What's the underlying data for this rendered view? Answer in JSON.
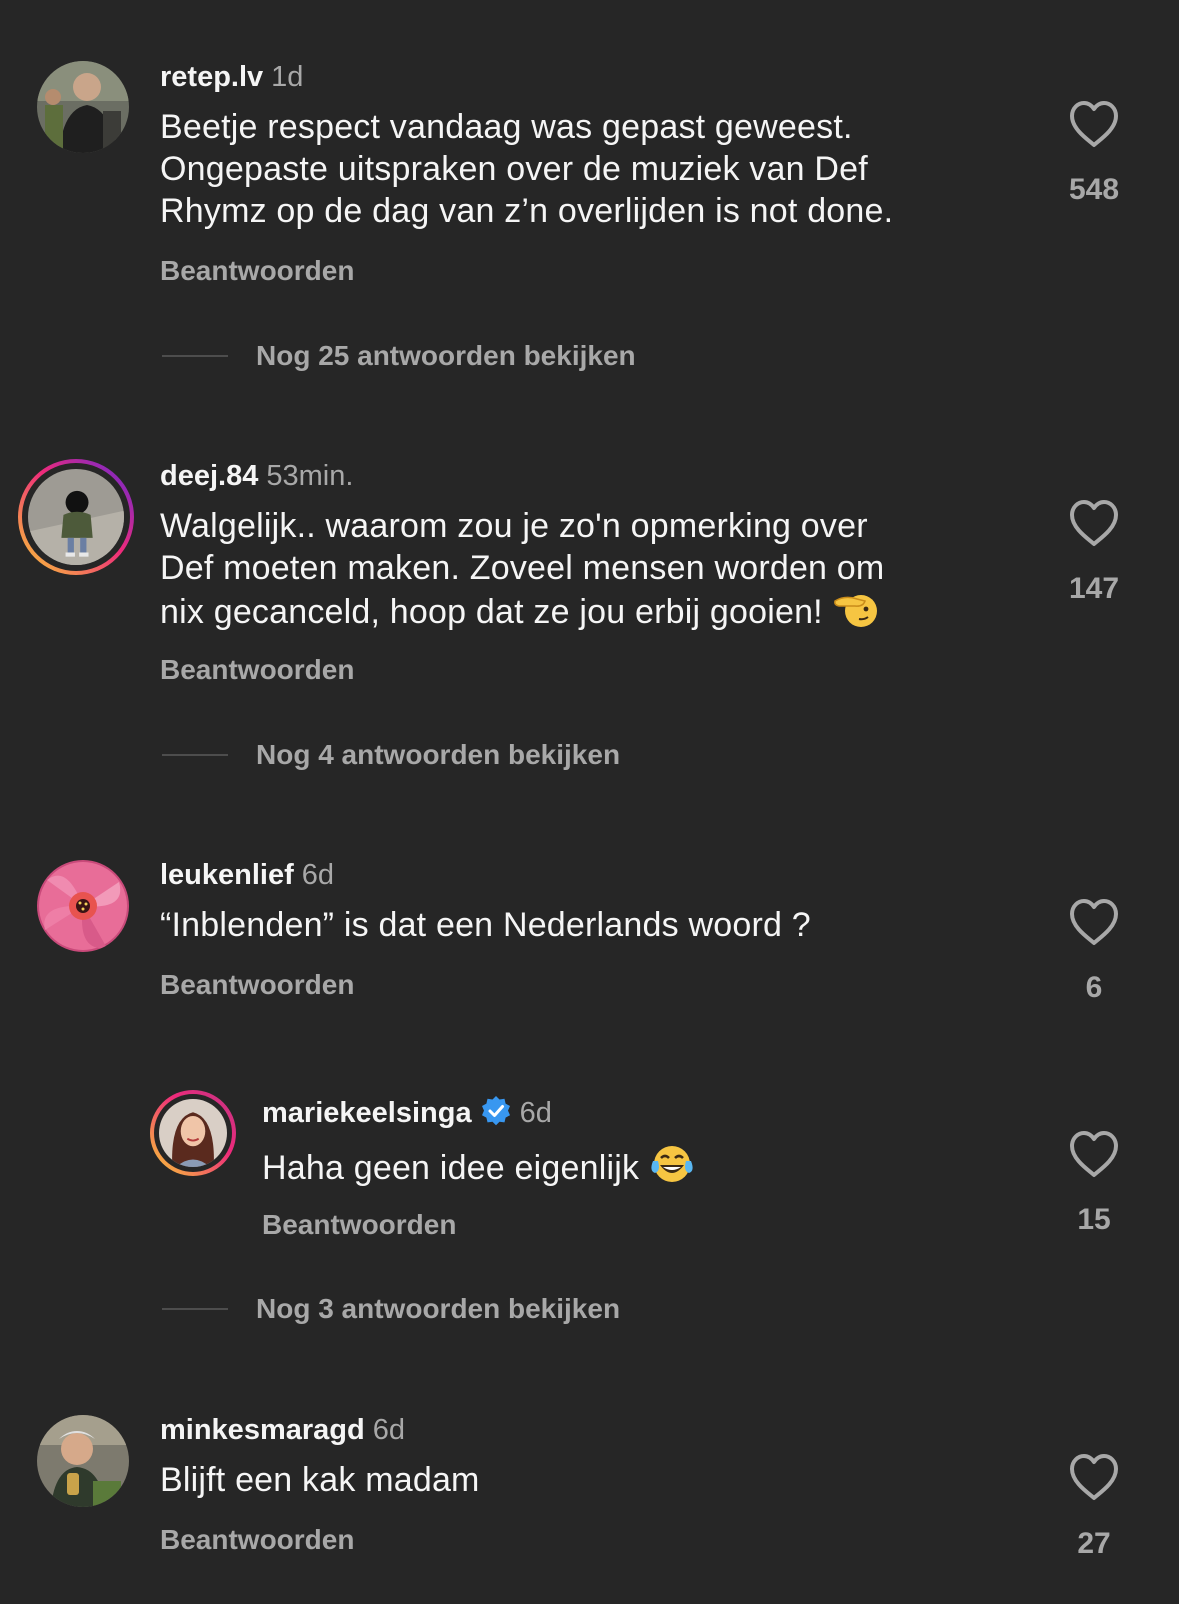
{
  "comments": [
    {
      "username": "retep.lv",
      "time": "1d",
      "lines": [
        "Beetje respect vandaag was gepast geweest.",
        "Ongepaste uitspraken over de muziek van Def",
        "Rhymz op de dag van z’n overlijden is not done."
      ],
      "reply_label": "Beantwoorden",
      "likes": "548",
      "more_replies": "Nog 25 antwoorden bekijken"
    },
    {
      "username": "deej.84",
      "time": "53min.",
      "lines": [
        "Walgelijk.. waarom zou je zo'n opmerking over",
        "Def moeten maken. Zoveel mensen worden om",
        "nix gecanceld, hoop dat ze jou erbij gooien!"
      ],
      "emoji": "saluting-face",
      "reply_label": "Beantwoorden",
      "likes": "147",
      "more_replies": "Nog 4 antwoorden bekijken"
    },
    {
      "username": "leukenlief",
      "time": "6d",
      "lines": [
        "“Inblenden” is dat een Nederlands woord ?"
      ],
      "reply_label": "Beantwoorden",
      "likes": "6",
      "reply": {
        "username": "mariekeelsinga",
        "verified": true,
        "time": "6d",
        "text": "Haha geen idee eigenlijk",
        "emoji": "tears-of-joy",
        "reply_label": "Beantwoorden",
        "likes": "15"
      },
      "more_replies": "Nog 3 antwoorden bekijken"
    },
    {
      "username": "minkesmaragd",
      "time": "6d",
      "lines": [
        "Blijft een kak madam"
      ],
      "reply_label": "Beantwoorden",
      "likes": "27"
    }
  ],
  "colors": {
    "background": "#262626",
    "primary_text": "#f5f5f5",
    "secondary_text": "#a8a8a8",
    "verified_blue": "#3897f0",
    "story_ring_start": "#f9ce34",
    "story_ring_mid": "#ee2a7b",
    "story_ring_end": "#6228d7"
  }
}
